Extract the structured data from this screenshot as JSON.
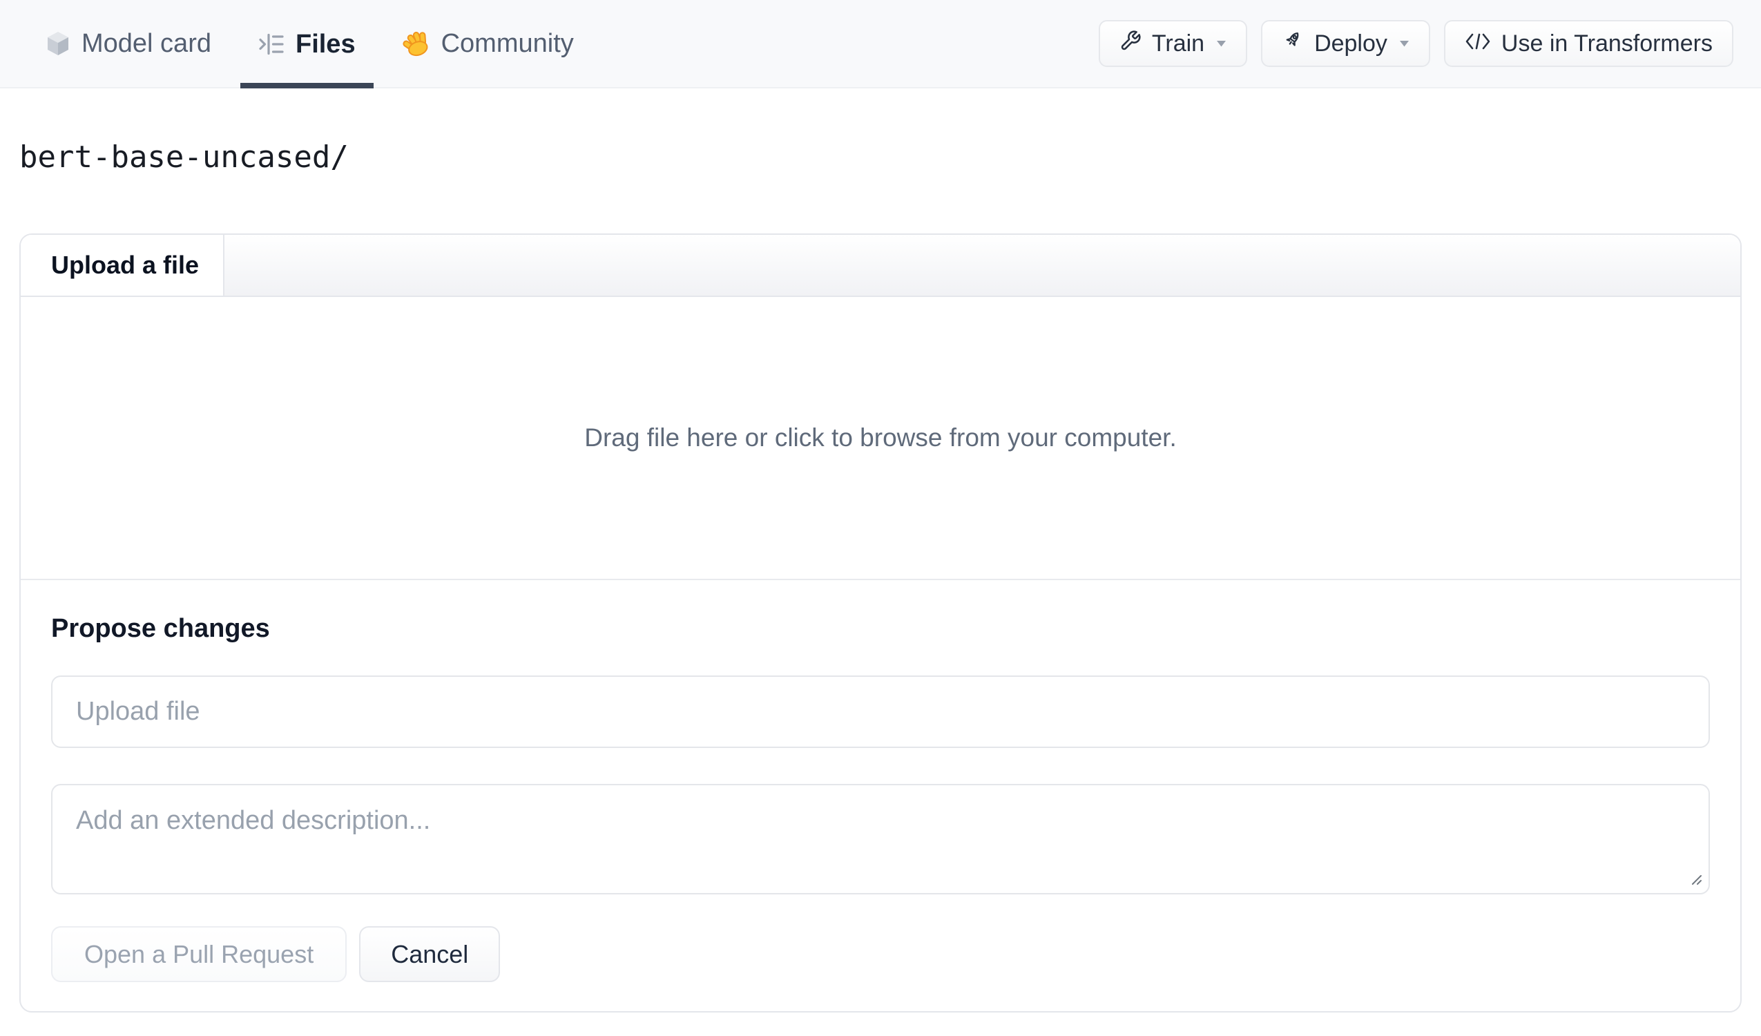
{
  "nav": {
    "tabs": [
      {
        "label": "Model card",
        "icon": "cube-icon",
        "active": false
      },
      {
        "label": "Files",
        "icon": "files-list-icon",
        "active": true
      },
      {
        "label": "Community",
        "icon": "waving-hand-icon",
        "active": false
      }
    ],
    "actions": [
      {
        "label": "Train",
        "icon": "wrench-icon",
        "has_caret": true
      },
      {
        "label": "Deploy",
        "icon": "rocket-icon",
        "has_caret": true
      },
      {
        "label": "Use in Transformers",
        "icon": "code-icon",
        "has_caret": false
      }
    ]
  },
  "breadcrumb": {
    "path": "bert-base-uncased/"
  },
  "upload_card": {
    "tab_label": "Upload a file",
    "dropzone_text": "Drag file here or click to browse from your computer.",
    "propose": {
      "heading": "Propose changes",
      "filename_placeholder": "Upload file",
      "description_placeholder": "Add an extended description...",
      "open_pr_label": "Open a Pull Request",
      "cancel_label": "Cancel"
    }
  },
  "colors": {
    "nav_bg": "#f8f9fb",
    "active_tab_underline": "#3b4556",
    "card_border": "#e4e6eb",
    "muted_text": "#5f6a7a",
    "placeholder_text": "#98a1ad",
    "hand_emoji_yellow": "#fcc231",
    "hand_emoji_orange": "#f0951e"
  }
}
